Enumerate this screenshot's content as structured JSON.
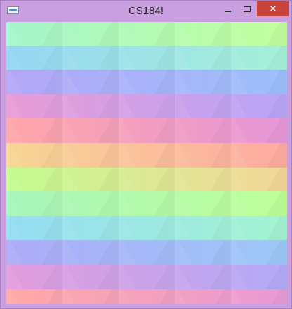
{
  "window": {
    "title": "CS184!",
    "icon": "app-icon",
    "controls": {
      "minimize_icon": "minimize-icon",
      "maximize_icon": "maximize-icon",
      "close_icon": "close-icon",
      "close_glyph": "✕"
    }
  },
  "canvas": {
    "bands": [
      {
        "from": "#a4f5cc",
        "to": "#c2ff9c"
      },
      {
        "from": "#96d6f4",
        "to": "#a6f0d8"
      },
      {
        "from": "#b4a6f8",
        "to": "#9cc0fb"
      },
      {
        "from": "#e89cd6",
        "to": "#b7a4f8"
      },
      {
        "from": "#ffa6a8",
        "to": "#e696d8"
      },
      {
        "from": "#f7d694",
        "to": "#ffaaa2"
      },
      {
        "from": "#c2fb8f",
        "to": "#f5d698"
      },
      {
        "from": "#a6f5bc",
        "to": "#bfff98"
      },
      {
        "from": "#95dcf4",
        "to": "#a4f4d2"
      },
      {
        "from": "#aeaaf8",
        "to": "#9cc8f8"
      },
      {
        "from": "#e29cdc",
        "to": "#b2aaf8"
      },
      {
        "from": "#ffa8a6",
        "to": "#e89ad6"
      }
    ]
  }
}
